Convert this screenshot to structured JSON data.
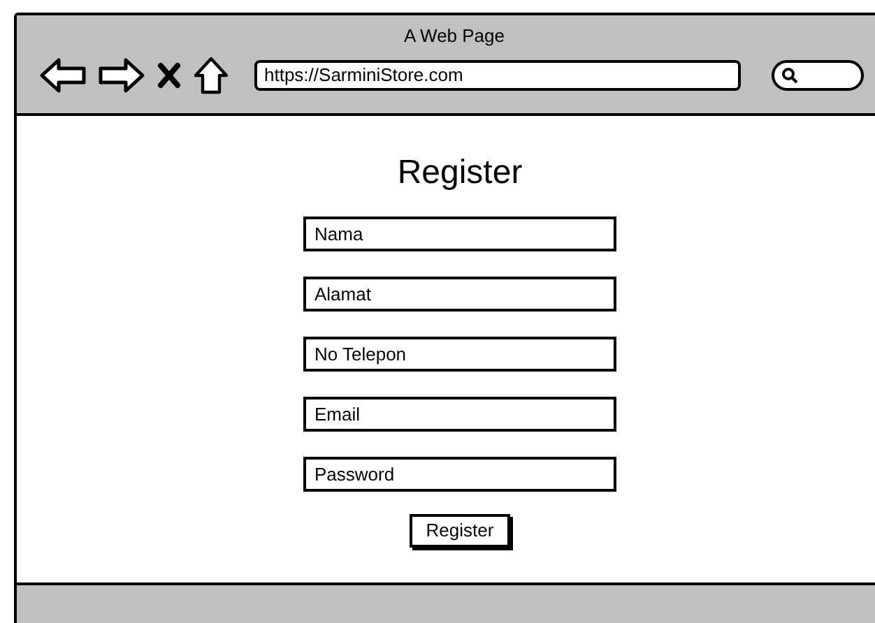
{
  "window": {
    "title": "A Web Page"
  },
  "address_bar": {
    "value": "https://SarminiStore.com"
  },
  "page": {
    "heading": "Register",
    "fields": [
      {
        "placeholder": "Nama"
      },
      {
        "placeholder": "Alamat"
      },
      {
        "placeholder": "No Telepon"
      },
      {
        "placeholder": "Email"
      },
      {
        "placeholder": "Password"
      }
    ],
    "submit": "Register"
  }
}
